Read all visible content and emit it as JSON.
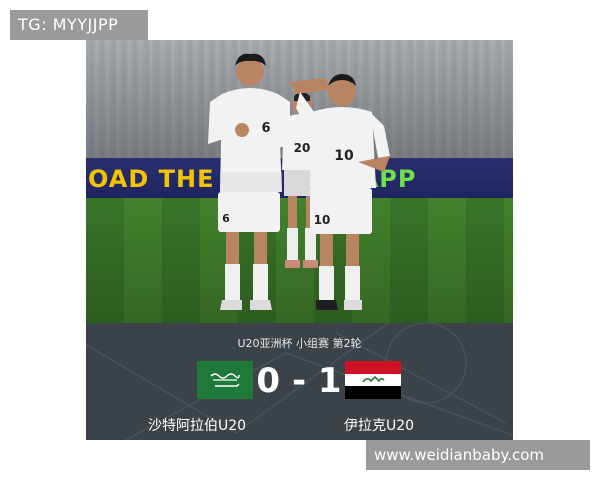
{
  "watermarks": {
    "top_left": "TG: MYYJJPP",
    "bottom_right": "www.weidianbaby.com"
  },
  "photo": {
    "ad_board_text_1": "OAD THE O",
    "ad_board_text_2": "C LIVE APP",
    "players": [
      {
        "number": "6"
      },
      {
        "number": "10"
      },
      {
        "number": "20"
      }
    ]
  },
  "match": {
    "competition": "U20亚洲杯 小组赛 第2轮",
    "home_score": "0",
    "separator": "-",
    "away_score": "1",
    "home_team": "沙特阿拉伯U20",
    "away_team": "伊拉克U20",
    "home_flag": "saudi-arabia-flag",
    "away_flag": "iraq-flag"
  },
  "colors": {
    "panel": "#3b4248",
    "saudi_green": "#1f7a3a",
    "iraq_red": "#ce1126",
    "iraq_black": "#000000",
    "iraq_emblem_green": "#2a7a34"
  }
}
